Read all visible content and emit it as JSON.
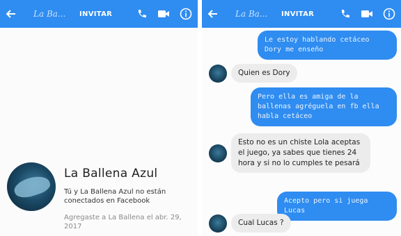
{
  "screens": [
    {
      "header": {
        "back_icon": "arrow-left-icon",
        "title": "La Ba...",
        "invite_label": "INVITAR"
      },
      "profile": {
        "name": "La Ballena Azul",
        "subtitle": "Tú y La Ballena Azul no están conectados en Facebook",
        "added": "Agregaste a La Ballena el abr. 29, 2017"
      }
    },
    {
      "header": {
        "back_icon": "arrow-left-icon",
        "title": "La Ba...",
        "invite_label": "INVITAR"
      },
      "messages": [
        {
          "from": "me",
          "text": "Le estoy hablando cetáceo Dory me enseño"
        },
        {
          "from": "them",
          "text": "Quien es Dory"
        },
        {
          "from": "me",
          "text": "Pero ella es amiga de la ballenas agréguela en fb ella habla cetáceo"
        },
        {
          "from": "them",
          "text": "Esto no es un chiste Lola aceptas el juego, ya sabes que tienes 24 hora y si no lo cumples te pesará"
        },
        {
          "from": "me",
          "text": "Acepto pero si juega Lucas"
        },
        {
          "from": "them",
          "text": "Cual Lucas ?"
        }
      ]
    }
  ],
  "colors": {
    "header_bg": "#2f8cf0",
    "outgoing_bubble": "#2f8cf0",
    "incoming_bubble": "#ececec"
  }
}
